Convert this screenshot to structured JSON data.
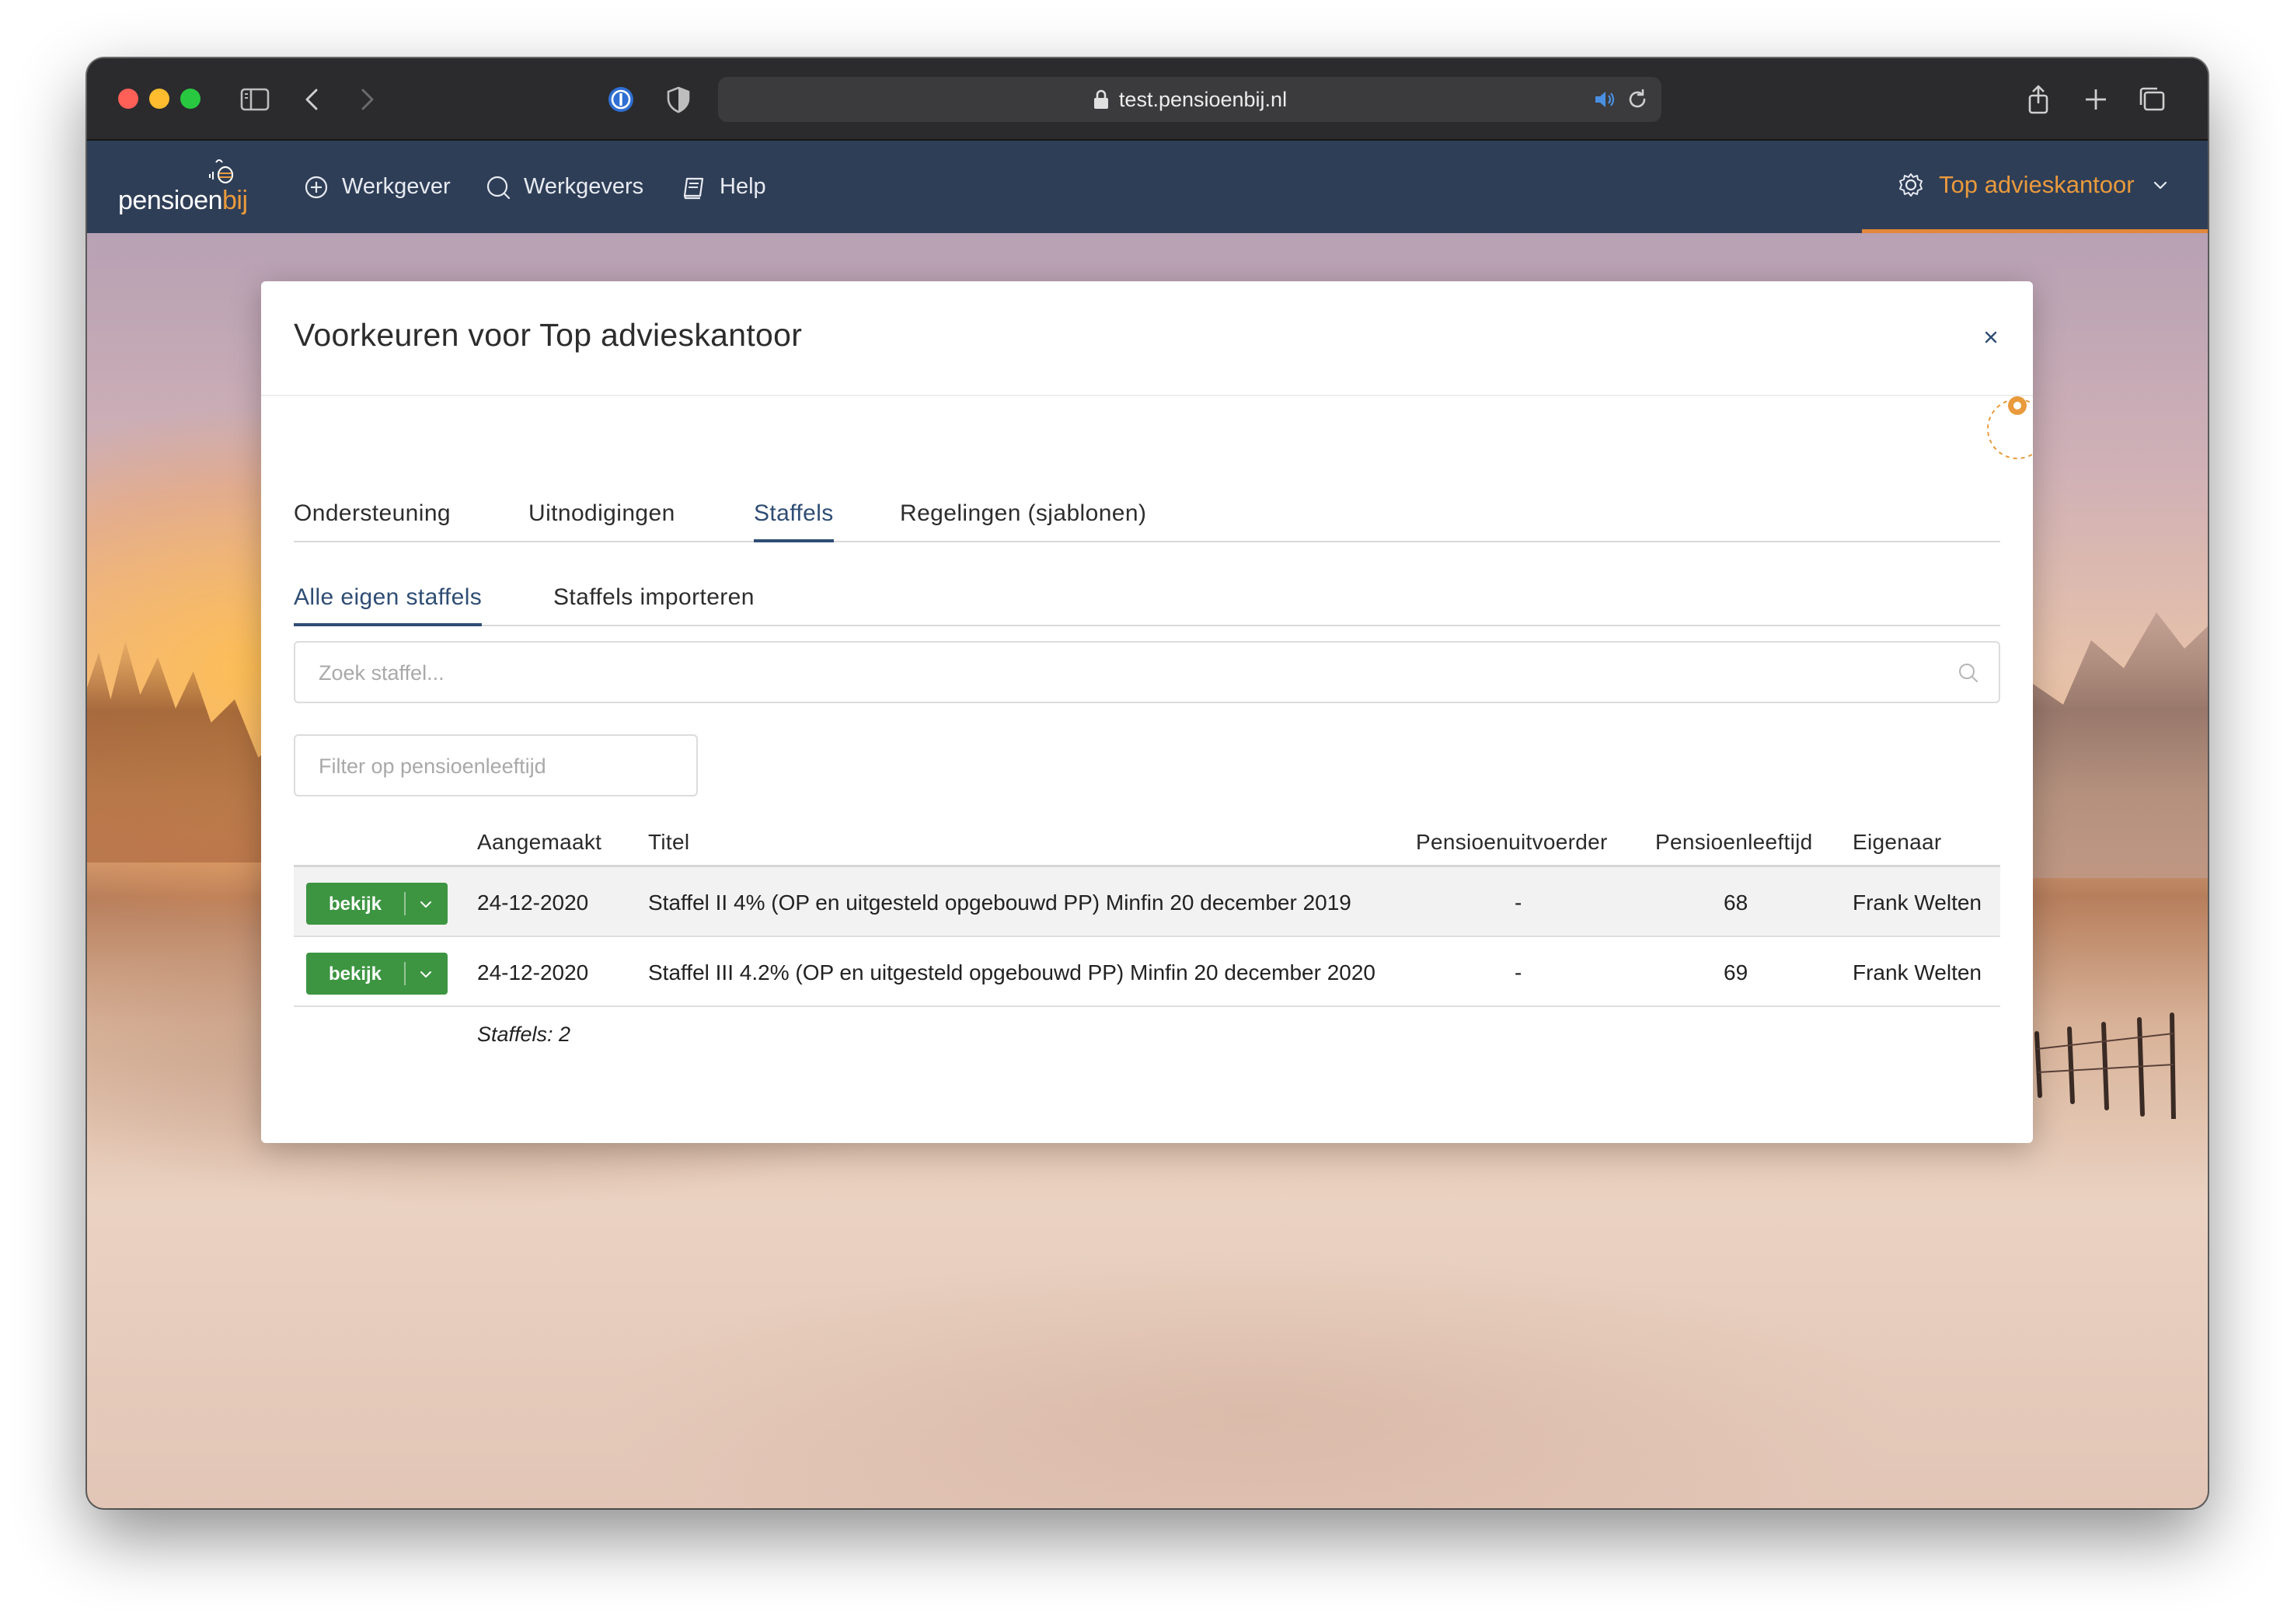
{
  "browser": {
    "url": "test.pensioenbij.nl"
  },
  "navbar": {
    "logo_text_main": "pensioen",
    "logo_text_accent": "bij",
    "items": [
      {
        "label": "Werkgever",
        "icon": "plus-circle-icon"
      },
      {
        "label": "Werkgevers",
        "icon": "search-icon"
      },
      {
        "label": "Help",
        "icon": "book-icon"
      }
    ],
    "account_label": "Top advieskantoor",
    "accent_color": "#e99a3c",
    "bar_color": "#2f3e57"
  },
  "modal": {
    "title": "Voorkeuren voor Top advieskantoor",
    "tabs": [
      "Ondersteuning",
      "Uitnodigingen",
      "Staffels",
      "Regelingen (sjablonen)"
    ],
    "active_tab": "Staffels",
    "subtabs": [
      "Alle eigen staffels",
      "Staffels importeren"
    ],
    "active_subtab": "Alle eigen staffels",
    "search_placeholder": "Zoek staffel...",
    "filter_placeholder": "Filter op pensioenleeftijd",
    "table": {
      "headers": [
        "Aangemaakt",
        "Titel",
        "Pensioenuitvoerder",
        "Pensioenleeftijd",
        "Eigenaar"
      ],
      "button_label": "bekijk",
      "rows": [
        {
          "created": "24-12-2020",
          "title": "Staffel II 4% (OP en uitgesteld opgebouwd PP) Minfin 20 december 2019",
          "provider": "-",
          "age": "68",
          "owner": "Frank Welten"
        },
        {
          "created": "24-12-2020",
          "title": "Staffel III 4.2% (OP en uitgesteld opgebouwd PP) Minfin 20 december 2020",
          "provider": "-",
          "age": "69",
          "owner": "Frank Welten"
        }
      ],
      "count_label": "Staffels: 2"
    },
    "button_color": "#3d9542",
    "active_tab_color": "#2f4d74"
  }
}
